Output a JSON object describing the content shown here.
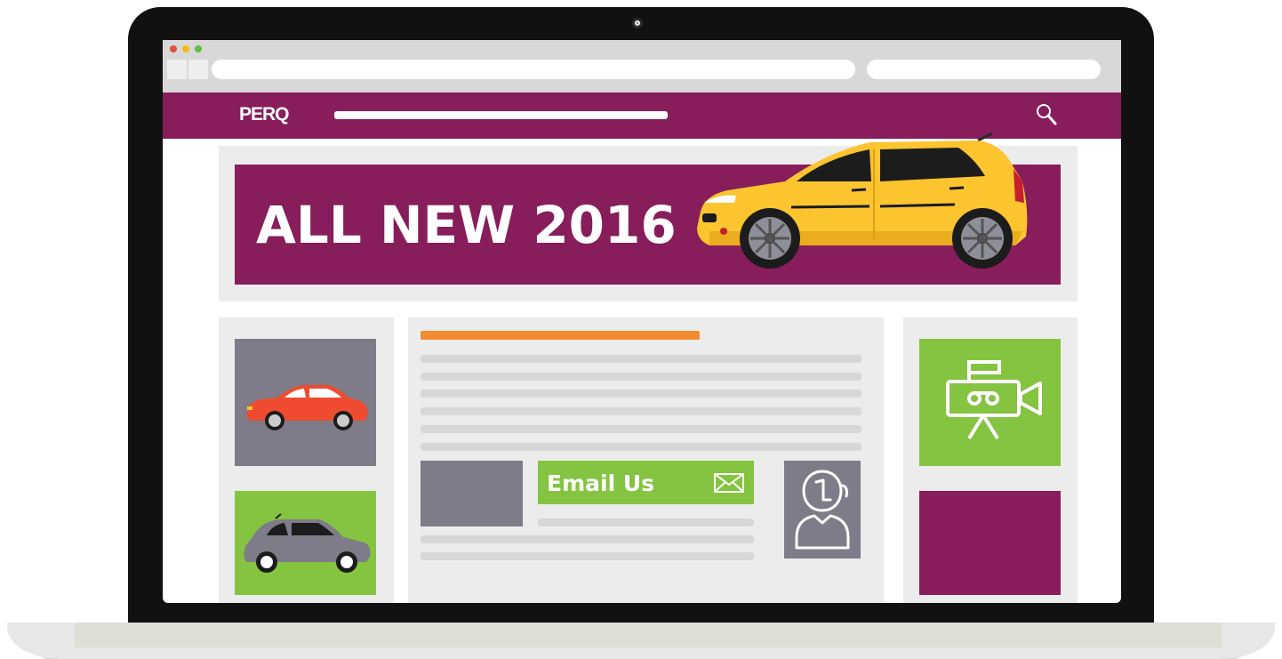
{
  "brand": {
    "logo_text": "PERQ"
  },
  "hero": {
    "title": "ALL NEW 2016"
  },
  "contact": {
    "email_label": "Email Us"
  },
  "colors": {
    "brand_purple": "#871d5b",
    "accent_green": "#84c441",
    "accent_orange": "#f28c30",
    "car_yellow": "#fcc42f",
    "car_red": "#ef4b30",
    "panel_gray": "#7d7c88"
  },
  "icons": {
    "search": "search-icon",
    "email": "envelope-icon",
    "video": "video-camera-icon",
    "avatar": "user-avatar-icon"
  }
}
